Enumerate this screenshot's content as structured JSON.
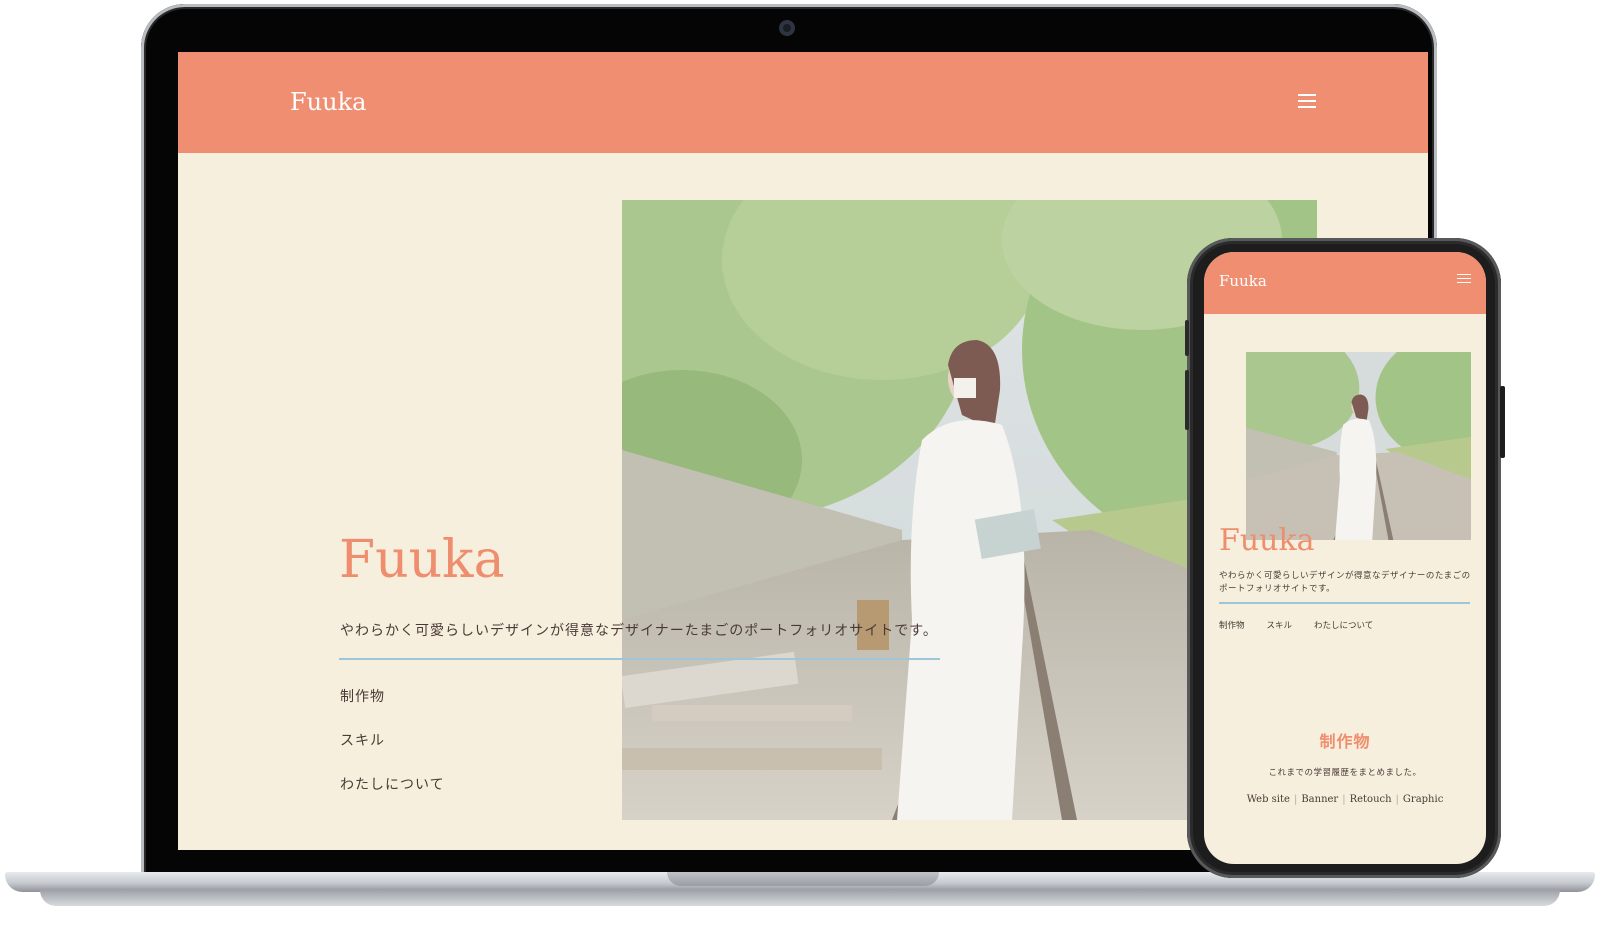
{
  "site": {
    "logo": "Fuuka",
    "title": "Fuuka",
    "tagline": "やわらかく可愛らしいデザインが得意なデザイナーたまごのポートフォリオサイトです。",
    "nav": [
      "制作物",
      "スキル",
      "わたしについて"
    ],
    "colors": {
      "accent": "#f08e72",
      "background": "#f7efde",
      "divider": "#9fc6d8",
      "text": "#4a3a36"
    }
  },
  "mobile": {
    "logo": "Fuuka",
    "title": "Fuuka",
    "tagline": "やわらかく可愛らしいデザインが得意なデザイナーのたまごのポートフォリオサイトです。",
    "nav": [
      "制作物",
      "スキル",
      "わたしについて"
    ],
    "works": {
      "title": "制作物",
      "description": "これまでの学習履歴をまとめました。",
      "categories": [
        "Web site",
        "Banner",
        "Retouch",
        "Graphic"
      ]
    }
  },
  "icons": [
    "hamburger-menu-icon",
    "camera-icon"
  ]
}
